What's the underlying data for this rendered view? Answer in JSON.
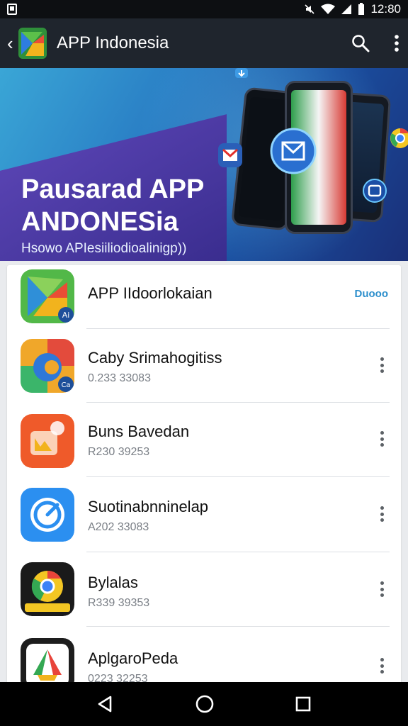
{
  "status_bar": {
    "time": "12:80",
    "icons": [
      "photo-icon",
      "mute-icon",
      "wifi-icon",
      "signal-icon",
      "battery-icon"
    ]
  },
  "app_bar": {
    "title": "APP Indonesia",
    "icons": [
      "back-chevron-icon",
      "app-logo-icon",
      "search-icon",
      "more-vert-icon"
    ]
  },
  "banner": {
    "title_line1": "Pausarad APP",
    "title_line2": "ANDONESia",
    "subtitle": "Hsowo APIesiiliodioalinigp))",
    "page_count": 4,
    "active_page": 0
  },
  "apps": [
    {
      "name": "APP IIdoorlokaian",
      "meta": "",
      "action": "Duooo",
      "icon": "app-indonesia-icon"
    },
    {
      "name": "Caby Srimahogitiss",
      "meta": "0.233 33083",
      "icon": "chrome-style-icon"
    },
    {
      "name": "Buns Bavedan",
      "meta": "R230 39253",
      "icon": "photo-app-icon"
    },
    {
      "name": "Suotinabnninelap",
      "meta": "A202 33083",
      "icon": "compass-app-icon"
    },
    {
      "name": "Bylalas",
      "meta": "R339 39353",
      "icon": "chrome-dark-icon"
    },
    {
      "name": "AplgaroPeda",
      "meta": "0223 32253",
      "icon": "triangle-app-icon"
    }
  ],
  "nav_bar": {
    "icons": [
      "back-icon",
      "home-icon",
      "recents-icon"
    ]
  },
  "colors": {
    "accent": "#2d8fcc",
    "app_bar": "#1f252d",
    "status_bar": "#0d0f12"
  }
}
